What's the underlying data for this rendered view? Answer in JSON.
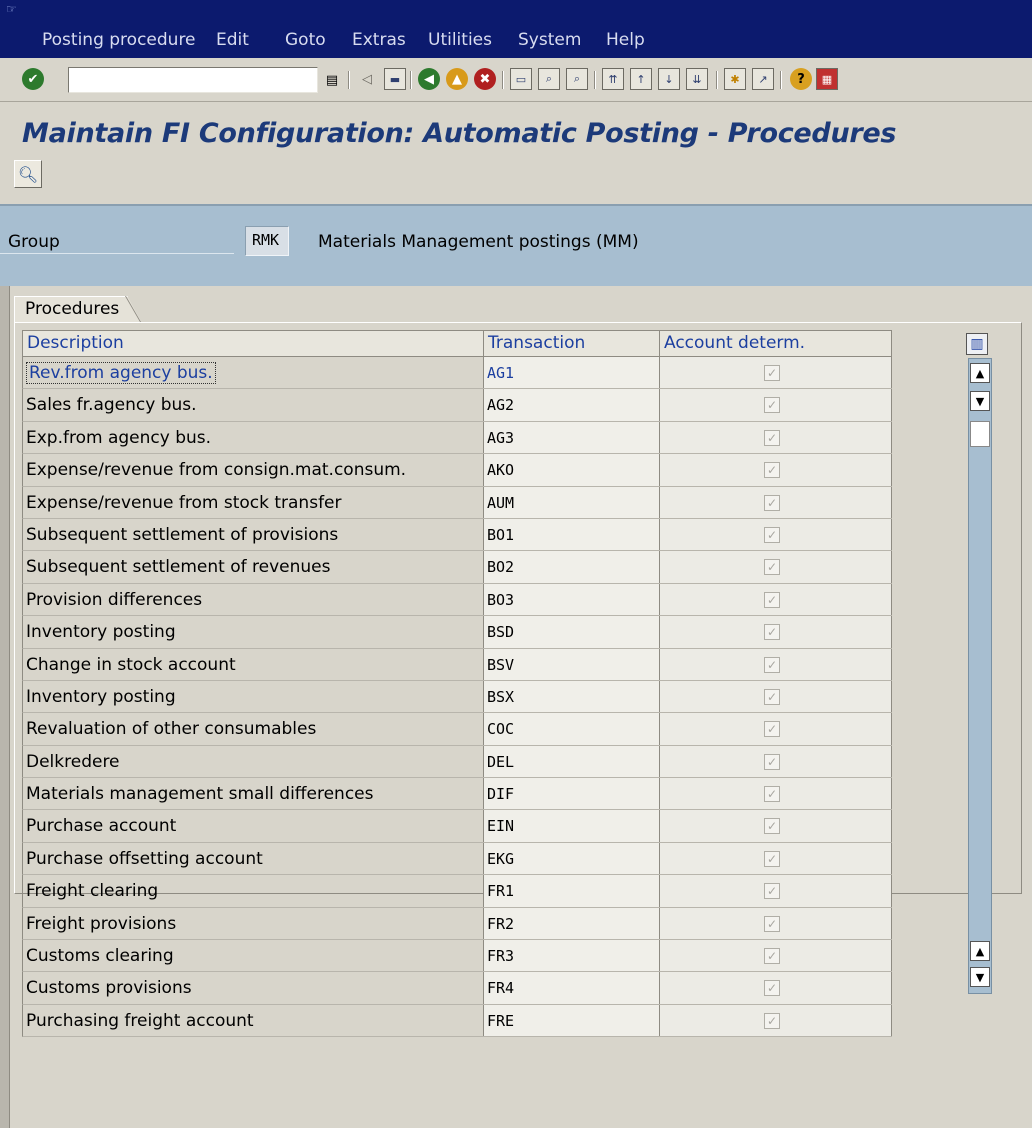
{
  "menubar": {
    "items": [
      {
        "label": "Posting procedure"
      },
      {
        "label": "Edit"
      },
      {
        "label": "Goto"
      },
      {
        "label": "Extras"
      },
      {
        "label": "Utilities"
      },
      {
        "label": "System"
      },
      {
        "label": "Help"
      }
    ]
  },
  "toolbar": {
    "command_value": "",
    "icons": [
      "enter-icon",
      "dropdown-icon",
      "back-nav-icon",
      "save-icon",
      "back-icon",
      "exit-icon",
      "cancel-icon",
      "print-icon",
      "find-icon",
      "find-next-icon",
      "first-page-icon",
      "previous-page-icon",
      "next-page-icon",
      "last-page-icon",
      "create-session-icon",
      "shortcut-icon",
      "help-icon",
      "customize-layout-icon"
    ]
  },
  "page": {
    "title": "Maintain FI Configuration: Automatic Posting - Procedures"
  },
  "header": {
    "group_label": "Group",
    "group_value": "RMK",
    "group_description": "Materials Management postings (MM)"
  },
  "tabs": [
    {
      "label": "Procedures"
    }
  ],
  "table": {
    "columns": [
      {
        "label": "Description"
      },
      {
        "label": "Transaction"
      },
      {
        "label": "Account determ."
      }
    ],
    "rows": [
      {
        "description": "Rev.from agency bus.",
        "transaction": "AG1",
        "account_determ": true
      },
      {
        "description": "Sales fr.agency bus.",
        "transaction": "AG2",
        "account_determ": true
      },
      {
        "description": "Exp.from agency bus.",
        "transaction": "AG3",
        "account_determ": true
      },
      {
        "description": "Expense/revenue from consign.mat.consum.",
        "transaction": "AKO",
        "account_determ": true
      },
      {
        "description": "Expense/revenue from stock transfer",
        "transaction": "AUM",
        "account_determ": true
      },
      {
        "description": "Subsequent settlement of provisions",
        "transaction": "BO1",
        "account_determ": true
      },
      {
        "description": "Subsequent settlement of revenues",
        "transaction": "BO2",
        "account_determ": true
      },
      {
        "description": "Provision differences",
        "transaction": "BO3",
        "account_determ": true
      },
      {
        "description": "Inventory posting",
        "transaction": "BSD",
        "account_determ": true
      },
      {
        "description": "Change in stock account",
        "transaction": "BSV",
        "account_determ": true
      },
      {
        "description": "Inventory posting",
        "transaction": "BSX",
        "account_determ": true
      },
      {
        "description": "Revaluation of other consumables",
        "transaction": "COC",
        "account_determ": true
      },
      {
        "description": "Delkredere",
        "transaction": "DEL",
        "account_determ": true
      },
      {
        "description": "Materials management small differences",
        "transaction": "DIF",
        "account_determ": true
      },
      {
        "description": "Purchase account",
        "transaction": "EIN",
        "account_determ": true
      },
      {
        "description": "Purchase offsetting account",
        "transaction": "EKG",
        "account_determ": true
      },
      {
        "description": "Freight clearing",
        "transaction": "FR1",
        "account_determ": true
      },
      {
        "description": "Freight provisions",
        "transaction": "FR2",
        "account_determ": true
      },
      {
        "description": "Customs clearing",
        "transaction": "FR3",
        "account_determ": true
      },
      {
        "description": "Customs provisions",
        "transaction": "FR4",
        "account_determ": true
      },
      {
        "description": "Purchasing freight account",
        "transaction": "FRE",
        "account_determ": true
      }
    ]
  }
}
